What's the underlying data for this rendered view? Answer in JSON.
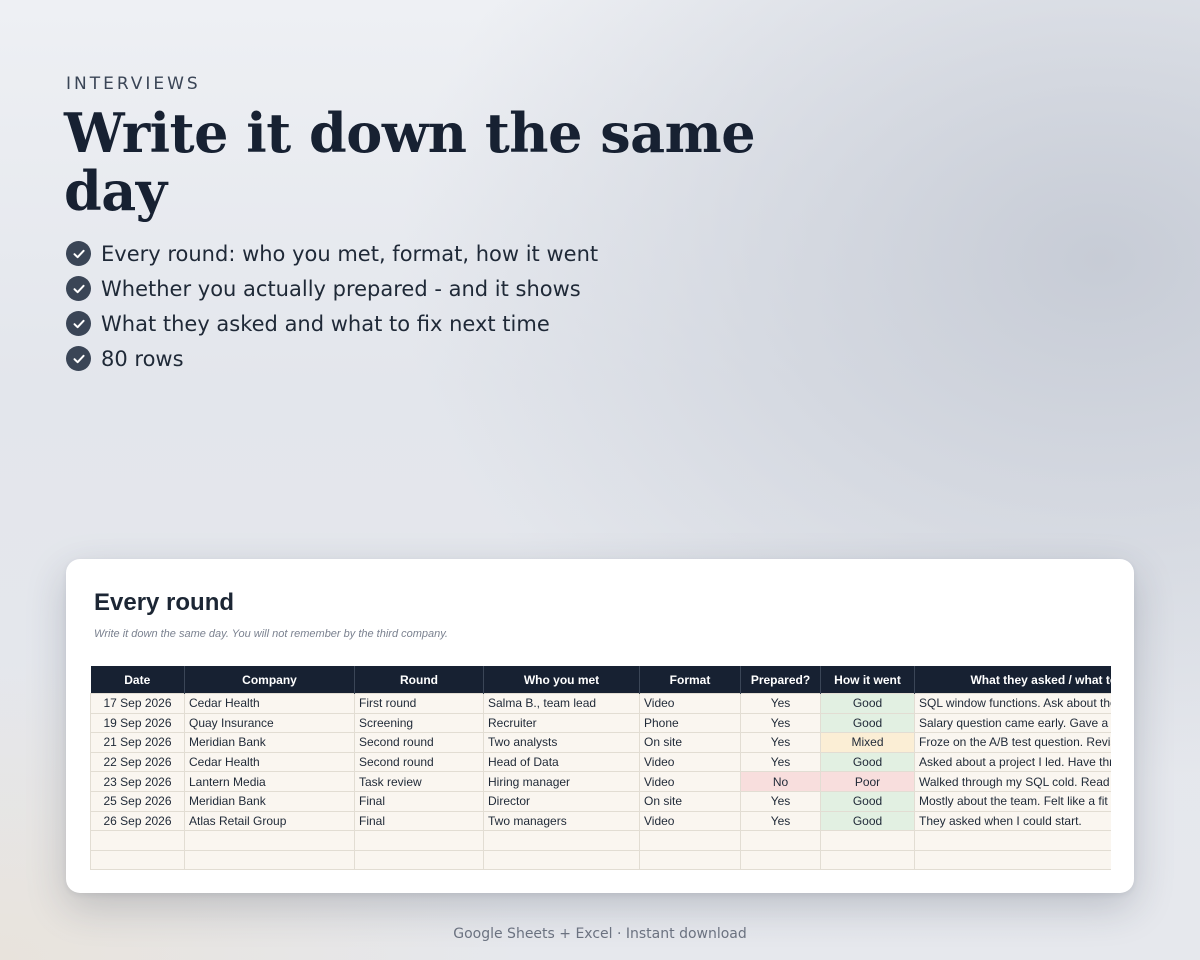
{
  "hero": {
    "eyebrow": "INTERVIEWS",
    "headline": "Write it down the same day",
    "features": [
      "Every round: who you met, format, how it went",
      "Whether you actually prepared - and it shows",
      "What they asked and what to fix next time",
      "80 rows"
    ]
  },
  "sheet": {
    "title": "Every round",
    "subtitle": "Write it down the same day. You will not remember by the third company.",
    "columns": [
      "Date",
      "Company",
      "Round",
      "Who you met",
      "Format",
      "Prepared?",
      "How it went",
      "What they asked / what to fix"
    ],
    "rows": [
      [
        "17 Sep 2026",
        "Cedar Health",
        "First round",
        "Salma B., team lead",
        "Video",
        "Yes",
        "Good",
        "SQL window functions. Ask about the"
      ],
      [
        "19 Sep 2026",
        "Quay Insurance",
        "Screening",
        "Recruiter",
        "Phone",
        "Yes",
        "Good",
        "Salary question came early. Gave a ra"
      ],
      [
        "21 Sep 2026",
        "Meridian Bank",
        "Second round",
        "Two analysts",
        "On site",
        "Yes",
        "Mixed",
        "Froze on the A/B test question. Revis"
      ],
      [
        "22 Sep 2026",
        "Cedar Health",
        "Second round",
        "Head of Data",
        "Video",
        "Yes",
        "Good",
        "Asked about a project I led. Have thr"
      ],
      [
        "23 Sep 2026",
        "Lantern Media",
        "Task review",
        "Hiring manager",
        "Video",
        "No",
        "Poor",
        "Walked through my SQL cold. Read y"
      ],
      [
        "25 Sep 2026",
        "Meridian Bank",
        "Final",
        "Director",
        "On site",
        "Yes",
        "Good",
        "Mostly about the team. Felt like a fit"
      ],
      [
        "26 Sep 2026",
        "Atlas Retail Group",
        "Final",
        "Two managers",
        "Video",
        "Yes",
        "Good",
        "They asked when I could start."
      ]
    ],
    "empty_rows": 2
  },
  "footer": {
    "text": "Google Sheets + Excel  ·  Instant download"
  },
  "colors": {
    "navy": "#172132",
    "good": "#e2f0e2",
    "mixed": "#fbeed5",
    "poor": "#f8dedd"
  }
}
